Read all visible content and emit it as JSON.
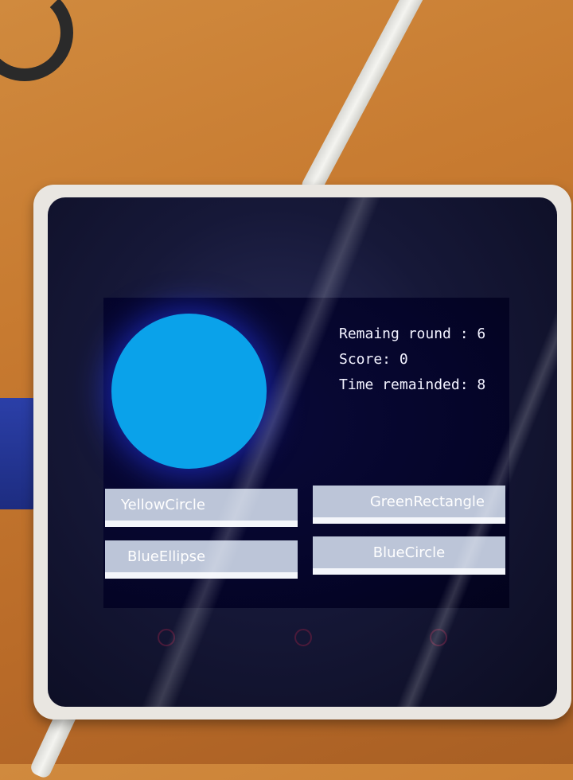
{
  "game": {
    "status": {
      "remaining_round": "Remaing round : 6",
      "score": "Score: 0",
      "time_remainded": "Time remainded: 8"
    },
    "shape_shown": {
      "kind": "circle",
      "color": "#0aa2ea"
    },
    "answers": [
      {
        "label": "YellowCircle"
      },
      {
        "label": "GreenRectangle"
      },
      {
        "label": "BlueEllipse"
      },
      {
        "label": "BlueCircle"
      }
    ]
  },
  "colors": {
    "screen_bg": "#05052a",
    "answer_bg": "#bcc5d8",
    "text": "#f2f2ff"
  }
}
